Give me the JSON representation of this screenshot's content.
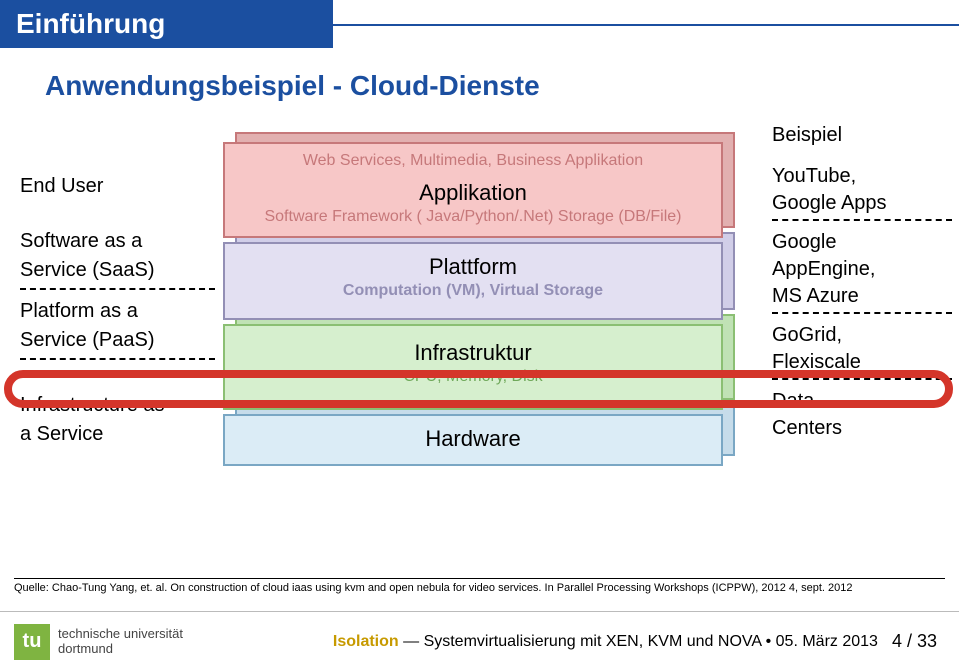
{
  "header": {
    "section": "Einführung"
  },
  "subtitle": "Anwendungsbeispiel - Cloud-Dienste",
  "left": {
    "enduser": "End User",
    "saas1": "Software as a",
    "saas2": "Service (SaaS)",
    "paas1": "Platform as a",
    "paas2": "Service (PaaS)",
    "iaas1": "Infrastructure as",
    "iaas2": "a Service"
  },
  "stack": {
    "app_top": "Web Services, Multimedia, Business Applikation",
    "app_title": "Applikation",
    "app_sub": "Software Framework ( Java/Python/.Net) Storage (DB/File)",
    "plat_title": "Plattform",
    "plat_sub": "Computation (VM), Virtual Storage",
    "inf_title": "Infrastruktur",
    "inf_sub": "CPU, Memory, Disk",
    "hw_title": "Hardware"
  },
  "right": {
    "heading": "Beispiel",
    "yt1": "YouTube,",
    "yt2": "Google Apps",
    "gae1": "Google",
    "gae2": "AppEngine,",
    "gae3": "MS Azure",
    "gg1": "GoGrid,",
    "gg2": "Flexiscale",
    "dc1": "Data",
    "dc2": "Centers"
  },
  "citation": "Quelle: Chao-Tung Yang, et. al. On construction of cloud iaas using kvm and open nebula for video services. In Parallel Processing Workshops (ICPPW), 2012 4, sept. 2012",
  "footer": {
    "uni1": "technische universität",
    "uni2": "dortmund",
    "mid_prefix": "Isolation",
    "mid_rest": " — Systemvirtualisierung mit XEN, KVM und NOVA • 05. März 2013",
    "page_current": "4",
    "page_sep": " / ",
    "page_total": "33"
  }
}
